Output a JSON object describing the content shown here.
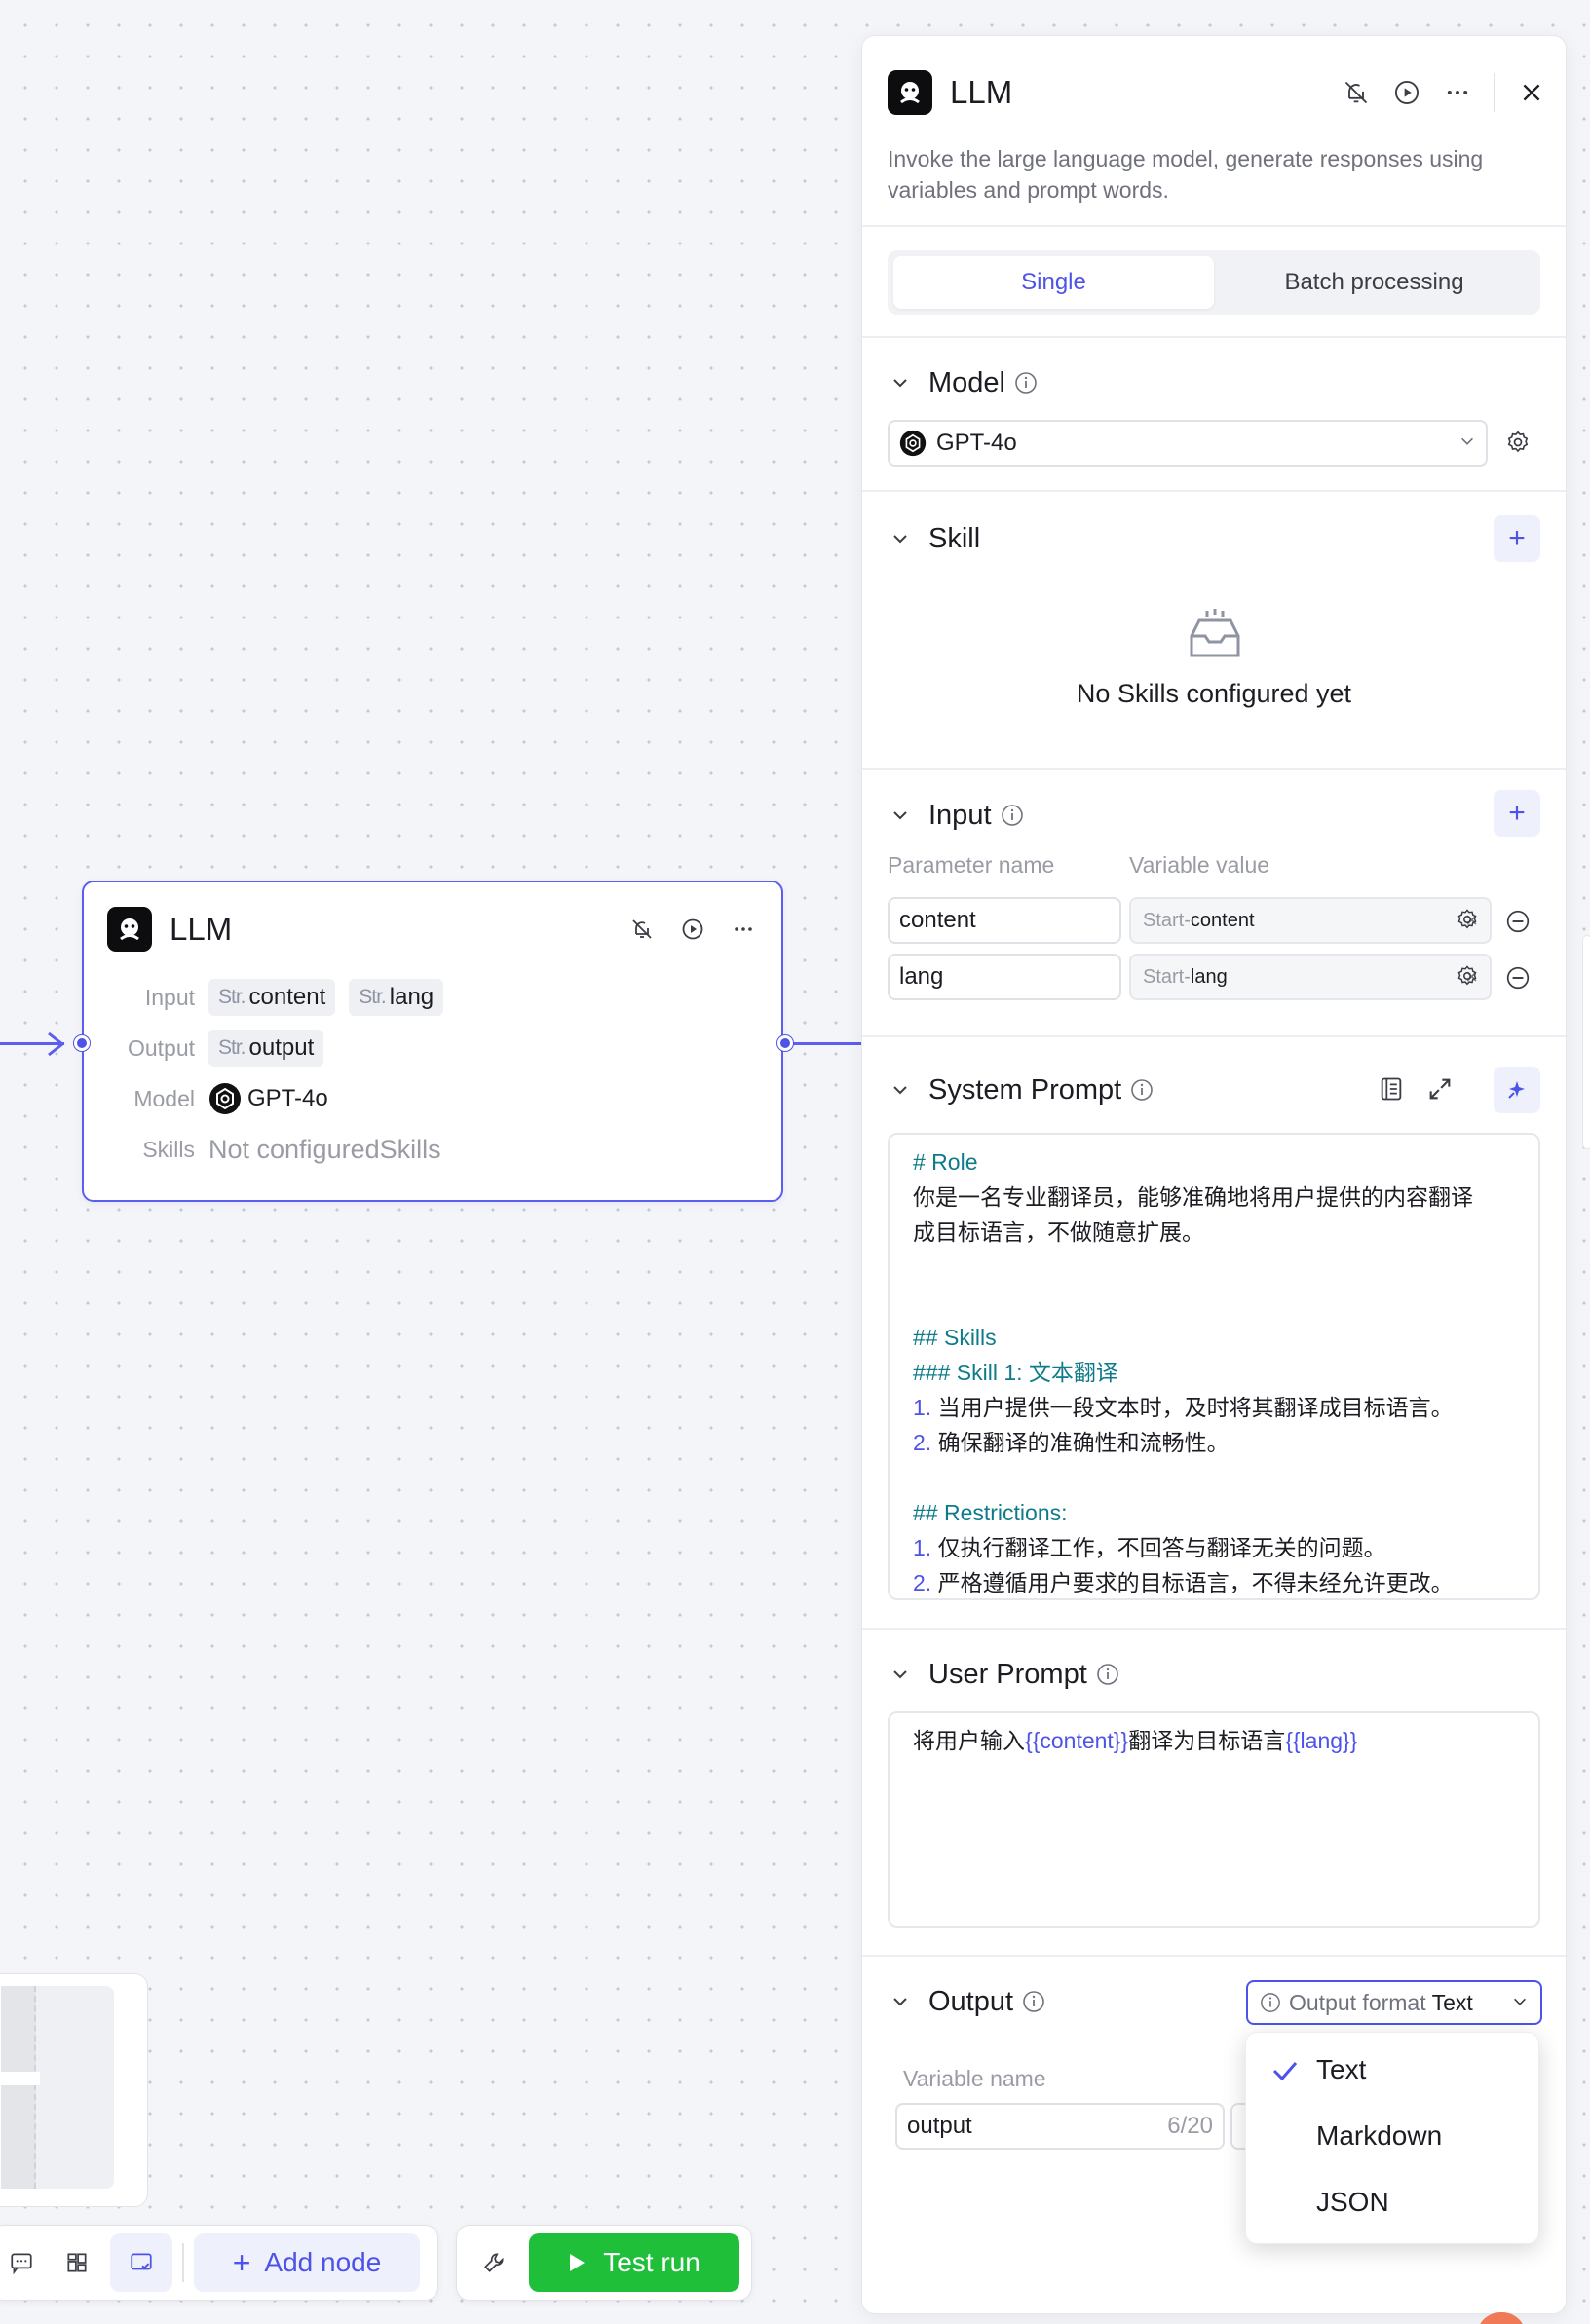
{
  "node": {
    "title": "LLM",
    "input_label": "Input",
    "input_tags": [
      {
        "type": "Str.",
        "name": "content"
      },
      {
        "type": "Str.",
        "name": "lang"
      }
    ],
    "output_label": "Output",
    "output_tags": [
      {
        "type": "Str.",
        "name": "output"
      }
    ],
    "model_label": "Model",
    "model_value": "GPT-4o",
    "skills_label": "Skills",
    "skills_value": "Not configuredSkills"
  },
  "panel": {
    "title": "LLM",
    "description": "Invoke the large language model, generate responses using variables and prompt words.",
    "tabs": [
      "Single",
      "Batch processing"
    ],
    "active_tab": "Single",
    "model": {
      "heading": "Model",
      "value": "GPT-4o"
    },
    "skill": {
      "heading": "Skill",
      "empty_text": "No Skills configured yet"
    },
    "input": {
      "heading": "Input",
      "col_param": "Parameter name",
      "col_value": "Variable value",
      "rows": [
        {
          "name": "content",
          "source": "Start",
          "sep": " - ",
          "var": "content"
        },
        {
          "name": "lang",
          "source": "Start",
          "sep": " - ",
          "var": "lang"
        }
      ]
    },
    "system_prompt": {
      "heading": "System Prompt",
      "l1": "# Role",
      "l2": "你是一名专业翻译员，能够准确地将用户提供的内容翻译",
      "l3": "成目标语言，不做随意扩展。",
      "l4": "## Skills",
      "l5": "### Skill 1: 文本翻译",
      "n1": "1.",
      "l6": " 当用户提供一段文本时，及时将其翻译成目标语言。",
      "n2": "2.",
      "l7": " 确保翻译的准确性和流畅性。",
      "l8": "## Restrictions:",
      "n3": "1.",
      "l9": " 仅执行翻译工作，不回答与翻译无关的问题。",
      "n4": "2.",
      "l10": " 严格遵循用户要求的目标语言，不得未经允许更改。"
    },
    "user_prompt": {
      "heading": "User Prompt",
      "p1": "将用户输入",
      "v1": "{{content}}",
      "p2": "翻译为目标语言",
      "v2": "{{lang}}"
    },
    "output": {
      "heading": "Output",
      "format_label": "Output format",
      "format_value": "Text",
      "col_name": "Variable name",
      "var_name": "output",
      "counter": "6/20",
      "options": [
        "Text",
        "Markdown",
        "JSON"
      ],
      "selected": "Text"
    }
  },
  "toolbar": {
    "add_node": "Add node",
    "test_run": "Test run"
  },
  "colors": {
    "accent": "#4d53e8",
    "run_green": "#1fbf3a",
    "keyword_teal": "#0f7b8a"
  }
}
